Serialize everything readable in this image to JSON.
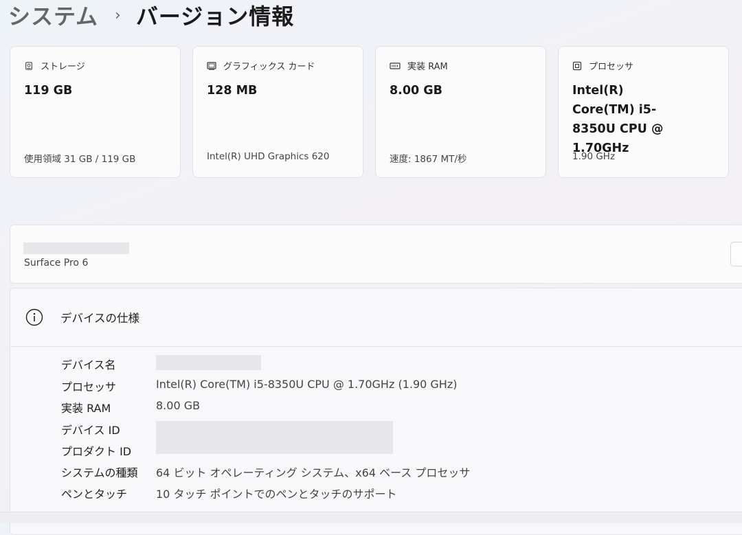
{
  "breadcrumb": {
    "parent": "システム",
    "separator": "›",
    "current": "バージョン情報"
  },
  "cards": [
    {
      "icon": "storage-icon",
      "title": "ストレージ",
      "value": "119 GB",
      "sub": "使用領域 31 GB / 119 GB"
    },
    {
      "icon": "graphics-card-icon",
      "title": "グラフィックス カード",
      "value": "128 MB",
      "sub": "Intel(R) UHD Graphics 620"
    },
    {
      "icon": "ram-icon",
      "title": "実装 RAM",
      "value": "8.00 GB",
      "sub": "速度: 1867 MT/秒"
    },
    {
      "icon": "processor-icon",
      "title": "プロセッサ",
      "value": "Intel(R) Core(TM) i5-8350U CPU @ 1.70GHz",
      "sub": "1.90 GHz"
    }
  ],
  "device": {
    "model": "Surface Pro 6"
  },
  "specs": {
    "title": "デバイスの仕様",
    "rows": [
      {
        "label": "デバイス名",
        "value": ""
      },
      {
        "label": "プロセッサ",
        "value": "Intel(R) Core(TM) i5-8350U CPU @ 1.70GHz (1.90 GHz)"
      },
      {
        "label": "実装 RAM",
        "value": "8.00 GB"
      },
      {
        "label": "デバイス ID",
        "value": ""
      },
      {
        "label": "プロダクト ID",
        "value": ""
      },
      {
        "label": "システムの種類",
        "value": "64 ビット オペレーティング システム、x64 ベース プロセッサ"
      },
      {
        "label": "ペンとタッチ",
        "value": "10 タッチ ポイントでのペンとタッチのサポート"
      }
    ]
  }
}
